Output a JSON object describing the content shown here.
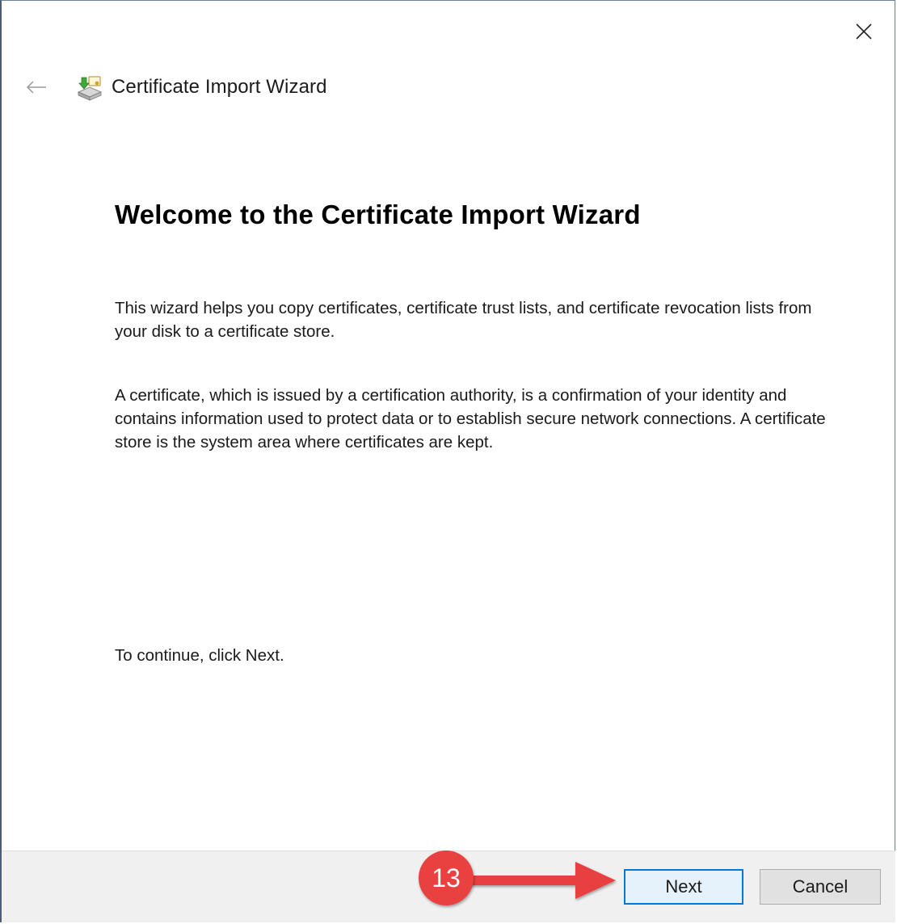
{
  "window": {
    "title": "Certificate Import Wizard"
  },
  "icons": {
    "close": "close-icon",
    "back": "back-arrow-icon",
    "app": "certificate-wizard-icon"
  },
  "content": {
    "heading": "Welcome to the Certificate Import Wizard",
    "paragraph_1": "This wizard helps you copy certificates, certificate trust lists, and certificate revocation lists from your disk to a certificate store.",
    "paragraph_2": "A certificate, which is issued by a certification authority, is a confirmation of your identity and contains information used to protect data or to establish secure network connections. A certificate store is the system area where certificates are kept.",
    "instruction": "To continue, click Next."
  },
  "footer": {
    "next_label": "Next",
    "cancel_label": "Cancel"
  },
  "annotation": {
    "step_number": "13",
    "color": "#e8413f"
  },
  "colors": {
    "accent": "#0078d7",
    "footer_bg": "#f0f0f0"
  }
}
